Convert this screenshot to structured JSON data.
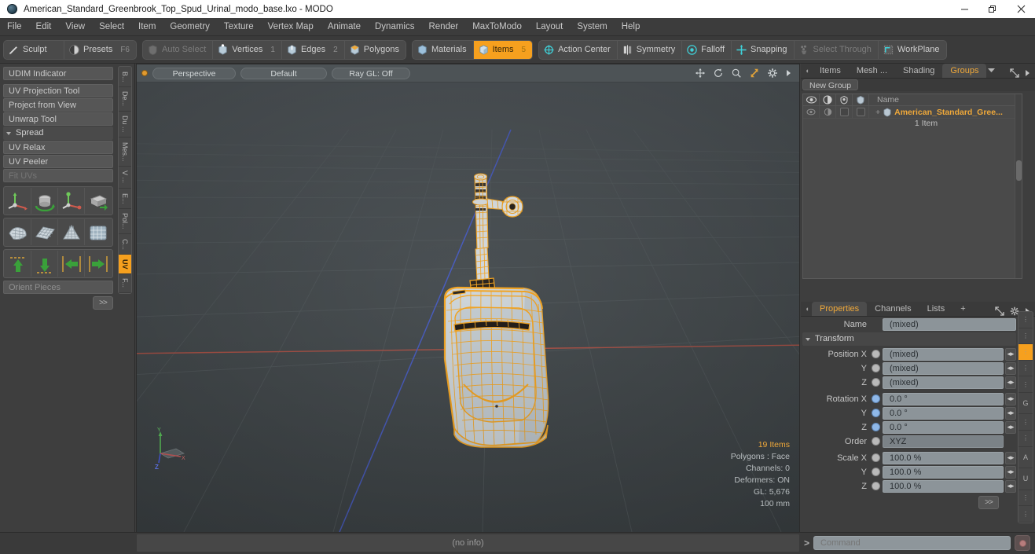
{
  "window": {
    "title": "American_Standard_Greenbrook_Top_Spud_Urinal_modo_base.lxo - MODO",
    "app_icon": "modo-sphere-icon",
    "minimize_label": "—",
    "maximize_label": "❐",
    "close_label": "✕"
  },
  "menubar": {
    "items": [
      {
        "label": "File"
      },
      {
        "label": "Edit"
      },
      {
        "label": "View"
      },
      {
        "label": "Select"
      },
      {
        "label": "Item"
      },
      {
        "label": "Geometry"
      },
      {
        "label": "Texture"
      },
      {
        "label": "Vertex Map"
      },
      {
        "label": "Animate"
      },
      {
        "label": "Dynamics"
      },
      {
        "label": "Render"
      },
      {
        "label": "MaxToModo"
      },
      {
        "label": "Layout"
      },
      {
        "label": "System"
      },
      {
        "label": "Help"
      }
    ]
  },
  "modebar": {
    "group1": [
      {
        "label": "Sculpt",
        "icon": "brush-icon",
        "state": "normal",
        "num": ""
      },
      {
        "label": "Presets",
        "icon": "sphere-icon",
        "state": "normal",
        "num": "F6"
      }
    ],
    "group2": [
      {
        "label": "Auto Select",
        "icon": "shield-icon",
        "state": "dim",
        "num": ""
      },
      {
        "label": "Vertices",
        "icon": "cube-vertex-icon",
        "state": "normal",
        "num": "1"
      },
      {
        "label": "Edges",
        "icon": "cube-edge-icon",
        "state": "normal",
        "num": "2"
      },
      {
        "label": "Polygons",
        "icon": "cube-poly-icon",
        "state": "normal",
        "num": ""
      }
    ],
    "group3": [
      {
        "label": "Materials",
        "icon": "cube-material-icon",
        "state": "normal",
        "num": ""
      },
      {
        "label": "Items",
        "icon": "cube-item-icon",
        "state": "active",
        "num": "5"
      }
    ],
    "group4": [
      {
        "label": "Action Center",
        "icon": "action-center-icon",
        "state": "normal",
        "num": ""
      },
      {
        "label": "Symmetry",
        "icon": "symmetry-icon",
        "state": "normal",
        "num": ""
      },
      {
        "label": "Falloff",
        "icon": "falloff-icon",
        "state": "normal",
        "num": ""
      },
      {
        "label": "Snapping",
        "icon": "snapping-icon",
        "state": "normal",
        "num": ""
      },
      {
        "label": "Select Through",
        "icon": "select-through-icon",
        "state": "dim",
        "num": ""
      },
      {
        "label": "WorkPlane",
        "icon": "workplane-icon",
        "state": "normal",
        "num": ""
      }
    ]
  },
  "left_panel": {
    "buttons_top": [
      {
        "label": "UDIM Indicator",
        "state": "normal"
      }
    ],
    "buttons_mid": [
      {
        "label": "UV Projection Tool",
        "state": "normal"
      },
      {
        "label": "Project from View",
        "state": "normal"
      },
      {
        "label": "Unwrap Tool",
        "state": "normal"
      }
    ],
    "section": {
      "label": "Spread"
    },
    "buttons_low": [
      {
        "label": "UV Relax",
        "state": "normal"
      },
      {
        "label": "UV Peeler",
        "state": "normal"
      },
      {
        "label": "Fit UVs",
        "state": "dim"
      }
    ],
    "icon_rows": [
      [
        "move-axis-icon",
        "rotate-cylinder-icon",
        "scale-axis-icon",
        "extrude-box-icon"
      ],
      [
        "uv-shell-icon",
        "uv-grid-plane-icon",
        "uv-cone-unwrap-icon",
        "uv-sphere-grid-icon"
      ],
      [
        "align-up-icon",
        "align-down-icon",
        "align-left-icon",
        "align-right-icon"
      ]
    ],
    "field": {
      "label": "Orient Pieces"
    },
    "more_button": {
      "label": ">>"
    },
    "vtabs": [
      {
        "label": "B...",
        "active": false
      },
      {
        "label": "De...",
        "active": false
      },
      {
        "label": "Du ...",
        "active": false
      },
      {
        "label": "Mes...",
        "active": false
      },
      {
        "label": "V ...",
        "active": false
      },
      {
        "label": "E...",
        "active": false
      },
      {
        "label": "Pol...",
        "active": false
      },
      {
        "label": "C...",
        "active": false
      },
      {
        "label": "UV",
        "active": true
      },
      {
        "label": "F...",
        "active": false
      }
    ]
  },
  "viewport": {
    "mode_label": "Perspective",
    "shading_label": "Default",
    "raygl_label": "Ray GL: Off",
    "tools": [
      "move-tool-icon",
      "rotate-tool-icon",
      "zoom-tool-icon",
      "fit-tool-icon",
      "gear-icon",
      "chevron-right-icon"
    ],
    "axis_gizmo": {
      "x": "X",
      "y": "Y",
      "z": "Z"
    },
    "stats": {
      "items": "19 Items",
      "polygons": "Polygons : Face",
      "channels": "Channels: 0",
      "deformers": "Deformers: ON",
      "gl": "GL: 5,676",
      "scale": "100 mm"
    },
    "colors": {
      "background_top": "#4f5457",
      "background_bottom": "#42474a",
      "wireframe": "#f5a623",
      "axis_x": "#b35545",
      "axis_z": "#4a5fc4",
      "grid": "#585f62"
    }
  },
  "right_top_panel": {
    "tabs": [
      {
        "label": "Items",
        "active": false
      },
      {
        "label": "Mesh ...",
        "active": false
      },
      {
        "label": "Shading",
        "active": false
      },
      {
        "label": "Groups",
        "active": true
      }
    ],
    "tab_overflow": "chevron-down-icon",
    "header_icons": [
      "expand-icon",
      "chevron-right-icon"
    ],
    "new_group_button": "New Group",
    "columns": [
      {
        "icon": "eye-icon"
      },
      {
        "icon": "render-icon"
      },
      {
        "icon": "lock-shape-icon"
      },
      {
        "icon": "select-shape-icon"
      },
      {
        "label": "Name"
      }
    ],
    "rows": [
      {
        "name": "American_Standard_Gree...",
        "icon": "group-icon",
        "expander": "+",
        "sub_label": "1 Item",
        "visible_icon": "eye-dim-icon",
        "render_icon": "render-dim-icon",
        "checkbox1": false,
        "checkbox2": false
      }
    ]
  },
  "properties_panel": {
    "tabs": [
      {
        "label": "Properties",
        "active": true
      },
      {
        "label": "Channels",
        "active": false
      },
      {
        "label": "Lists",
        "active": false
      },
      {
        "label": "+",
        "active": false
      }
    ],
    "header_icons": [
      "expand-icon",
      "gear-icon",
      "chevron-right-icon"
    ],
    "name_row": {
      "label": "Name",
      "value": "(mixed)"
    },
    "transform_section": {
      "label": "Transform"
    },
    "position": {
      "label": "Position X",
      "rows": [
        {
          "axis": "Position X",
          "value": "(mixed)",
          "radio": "grey"
        },
        {
          "axis": "Y",
          "value": "(mixed)",
          "radio": "grey"
        },
        {
          "axis": "Z",
          "value": "(mixed)",
          "radio": "grey"
        }
      ]
    },
    "rotation": {
      "rows": [
        {
          "axis": "Rotation X",
          "value": "0.0 °",
          "radio": "blue"
        },
        {
          "axis": "Y",
          "value": "0.0 °",
          "radio": "blue"
        },
        {
          "axis": "Z",
          "value": "0.0 °",
          "radio": "blue"
        }
      ]
    },
    "order": {
      "label": "Order",
      "value": "XYZ",
      "radio": "grey"
    },
    "scale": {
      "rows": [
        {
          "axis": "Scale X",
          "value": "100.0 %",
          "radio": "grey"
        },
        {
          "axis": "Y",
          "value": "100.0 %",
          "radio": "grey"
        },
        {
          "axis": "Z",
          "value": "100.0 %",
          "radio": "grey"
        }
      ]
    },
    "more_button": {
      "label": ">>"
    },
    "side_tabs": [
      {
        "label": "⋮",
        "active": false
      },
      {
        "label": "⋮",
        "active": false
      },
      {
        "label": "⋮",
        "active": true
      },
      {
        "label": "⋮",
        "active": false
      },
      {
        "label": "⋮",
        "active": false
      },
      {
        "label": "G",
        "active": false
      },
      {
        "label": "⋮",
        "active": false
      },
      {
        "label": "⋮",
        "active": false
      },
      {
        "label": "A",
        "active": false
      },
      {
        "label": "U",
        "active": false
      },
      {
        "label": "⋮",
        "active": false
      },
      {
        "label": "⋮",
        "active": false
      }
    ]
  },
  "statusbar": {
    "info": "(no info)",
    "command_caret": ">",
    "command_placeholder": "Command",
    "record_icon": "record-icon"
  },
  "theme": {
    "accent": "#f6a01e",
    "panel_bg": "#3e3e3e",
    "toolbar_bg": "#3a3a3a",
    "field_bg": "#8c9499",
    "text": "#c8c8c8"
  }
}
